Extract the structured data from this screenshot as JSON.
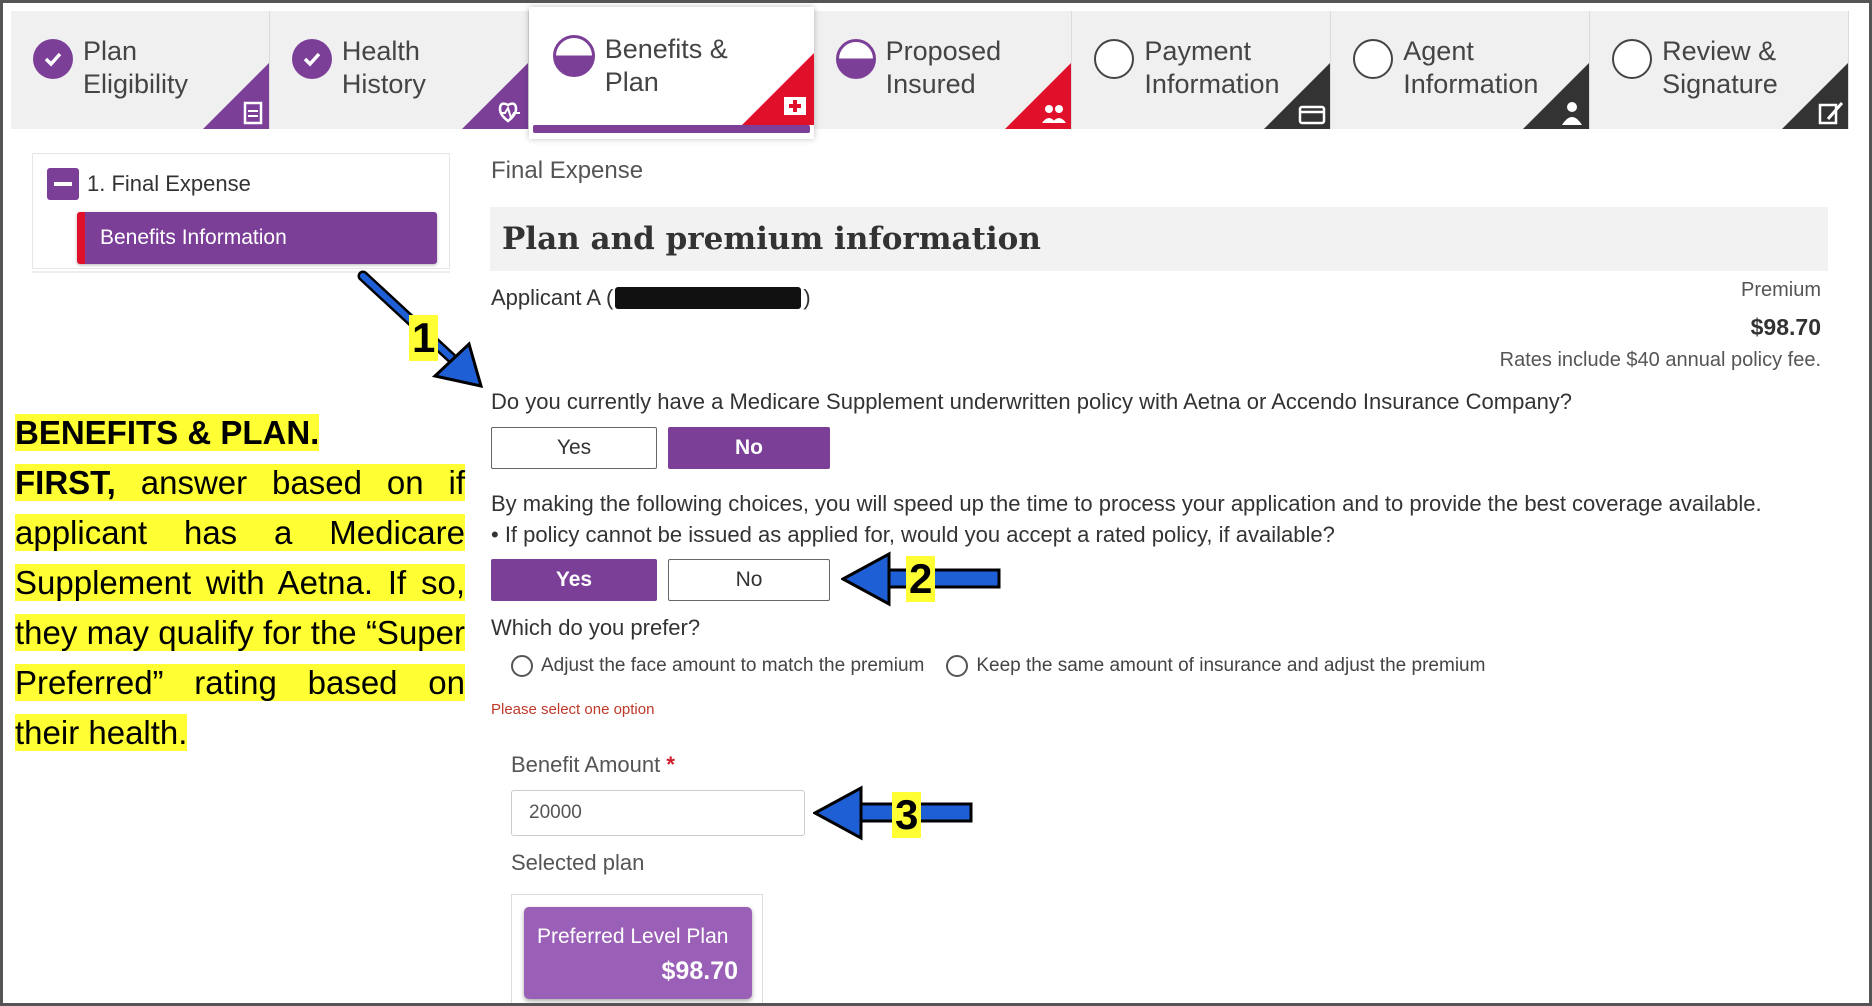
{
  "tabs": [
    {
      "line1": "Plan",
      "line2": "Eligibility",
      "status": "complete",
      "corner_color": "#7b3f98",
      "icon": "document-icon"
    },
    {
      "line1": "Health",
      "line2": "History",
      "status": "complete",
      "corner_color": "#7b3f98",
      "icon": "heartbeat-icon"
    },
    {
      "line1": "Benefits &",
      "line2": "Plan",
      "status": "active",
      "corner_color": "#e0102a",
      "icon": "medical-plus-icon"
    },
    {
      "line1": "Proposed",
      "line2": "Insured",
      "status": "in-progress",
      "corner_color": "#e0102a",
      "icon": "people-icon"
    },
    {
      "line1": "Payment",
      "line2": "Information",
      "status": "pending",
      "corner_color": "#333333",
      "icon": "credit-card-icon"
    },
    {
      "line1": "Agent",
      "line2": "Information",
      "status": "pending",
      "corner_color": "#333333",
      "icon": "agent-icon"
    },
    {
      "line1": "Review &",
      "line2": "Signature",
      "status": "pending",
      "corner_color": "#333333",
      "icon": "signature-icon"
    }
  ],
  "sidebar": {
    "section": "1. Final Expense",
    "item": "Benefits Information"
  },
  "main": {
    "breadcrumb": "Final Expense",
    "heading": "Plan and premium information",
    "applicant_prefix": "Applicant A (",
    "applicant_suffix": ")",
    "premium_label": "Premium",
    "premium_value": "$98.70",
    "premium_note": "Rates include $40 annual policy fee.",
    "q1": "Do you currently have a Medicare Supplement underwritten policy with Aetna or Accendo Insurance Company?",
    "q1_yes": "Yes",
    "q1_no": "No",
    "q1_selected": "No",
    "intro": "By making the following choices, you will speed up the time to process your application and to provide the best coverage available.",
    "q2": "• If policy cannot be issued as applied for, would you accept a rated policy, if available?",
    "q2_yes": "Yes",
    "q2_no": "No",
    "q2_selected": "Yes",
    "q3": "Which do you prefer?",
    "opt1": "Adjust the face amount to match the premium",
    "opt2": "Keep the same amount of insurance and adjust the premium",
    "error": "Please select one option",
    "benefit_label": "Benefit Amount",
    "required_mark": "*",
    "benefit_value": "20000",
    "selected_plan_label": "Selected plan",
    "plan_name": "Preferred Level Plan",
    "plan_price": "$98.70"
  },
  "annotation": {
    "title": "BENEFITS & PLAN.",
    "first": "FIRST,",
    "body1": "answer based on if",
    "body2": "applicant has a Medicare Supplement with Aetna. If so, they may qualify for the “Super Preferred” rating based on their health.",
    "marker1": "1",
    "marker2": "2",
    "marker3": "3",
    "highlight_color": "#ffff33",
    "arrow_color": "#1f5fd6"
  },
  "colors": {
    "accent": "#7b3f98",
    "alert": "#e0102a"
  }
}
